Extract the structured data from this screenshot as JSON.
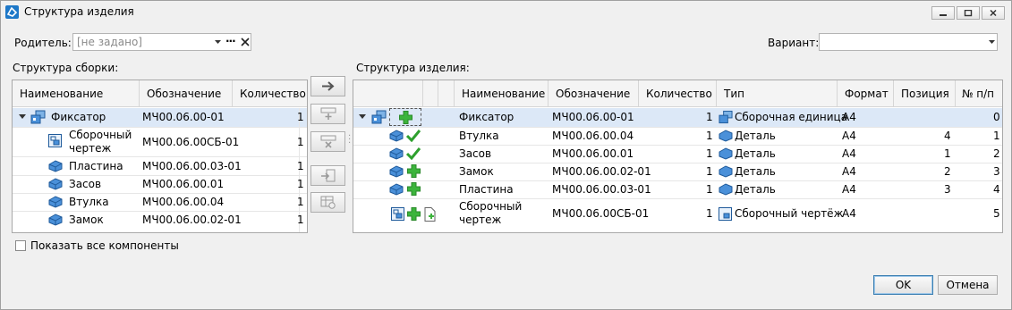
{
  "window": {
    "title": "Структура изделия",
    "minimize_icon": "minimize-icon",
    "maximize_icon": "maximize-icon",
    "close_icon": "close-icon"
  },
  "parent": {
    "label": "Родитель:",
    "value": "[не задано]",
    "ellipsis": "···"
  },
  "variant": {
    "label": "Вариант:",
    "value": ""
  },
  "assembly": {
    "title": "Структура сборки:",
    "columns": [
      "Наименование",
      "Обозначение",
      "Количество"
    ],
    "rows": [
      {
        "name": "Фиксатор",
        "designation": "МЧ00.06.00-01",
        "qty": "1",
        "icon": "assembly-icon",
        "level": 0
      },
      {
        "name": "Сборочный чертеж",
        "name_line1": "Сборочный",
        "name_line2": "чертеж",
        "designation": "МЧ00.06.00СБ-01",
        "qty": "1",
        "icon": "drawing-icon",
        "level": 1
      },
      {
        "name": "Пластина",
        "designation": "МЧ00.06.00.03-01",
        "qty": "1",
        "icon": "part-icon",
        "level": 1
      },
      {
        "name": "Засов",
        "designation": "МЧ00.06.00.01",
        "qty": "1",
        "icon": "part-icon",
        "level": 1
      },
      {
        "name": "Втулка",
        "designation": "МЧ00.06.00.04",
        "qty": "1",
        "icon": "part-icon",
        "level": 1
      },
      {
        "name": "Замок",
        "designation": "МЧ00.06.00.02-01",
        "qty": "1",
        "icon": "part-icon",
        "level": 1
      }
    ]
  },
  "product": {
    "title": "Структура изделия:",
    "columns": [
      "Наименование",
      "Обозначение",
      "Количество",
      "Тип",
      "Формат",
      "Позиция",
      "№ п/п"
    ],
    "rows": [
      {
        "name": "Фиксатор",
        "designation": "МЧ00.06.00-01",
        "qty": "1",
        "type": "Сборочная единица",
        "format": "А4",
        "position": "",
        "num": "0",
        "status": "add"
      },
      {
        "name": "Втулка",
        "designation": "МЧ00.06.00.04",
        "qty": "1",
        "type": "Деталь",
        "format": "А4",
        "position": "4",
        "num": "1",
        "status": "ok"
      },
      {
        "name": "Засов",
        "designation": "МЧ00.06.00.01",
        "qty": "1",
        "type": "Деталь",
        "format": "А4",
        "position": "1",
        "num": "2",
        "status": "ok"
      },
      {
        "name": "Замок",
        "designation": "МЧ00.06.00.02-01",
        "qty": "1",
        "type": "Деталь",
        "format": "А4",
        "position": "2",
        "num": "3",
        "status": "add"
      },
      {
        "name": "Пластина",
        "designation": "МЧ00.06.00.03-01",
        "qty": "1",
        "type": "Деталь",
        "format": "А4",
        "position": "3",
        "num": "4",
        "status": "add"
      },
      {
        "name": "Сборочный чертеж",
        "name_line1": "Сборочный",
        "name_line2": "чертеж",
        "designation": "МЧ00.06.00СБ-01",
        "qty": "1",
        "type": "Сборочный чертёж",
        "format": "А4",
        "position": "",
        "num": "5",
        "status": "add"
      }
    ]
  },
  "middle_buttons": [
    "arrow-right-icon",
    "insert-row-icon",
    "delete-row-icon",
    "import-icon",
    "table-settings-icon"
  ],
  "show_all": {
    "label": "Показать все компоненты",
    "checked": false
  },
  "buttons": {
    "ok": "OK",
    "cancel": "Отмена"
  },
  "colors": {
    "selection": "#dce8f7",
    "accent": "#1e78c8",
    "ok_green": "#2ea02e",
    "add_green": "#3cb43c"
  }
}
